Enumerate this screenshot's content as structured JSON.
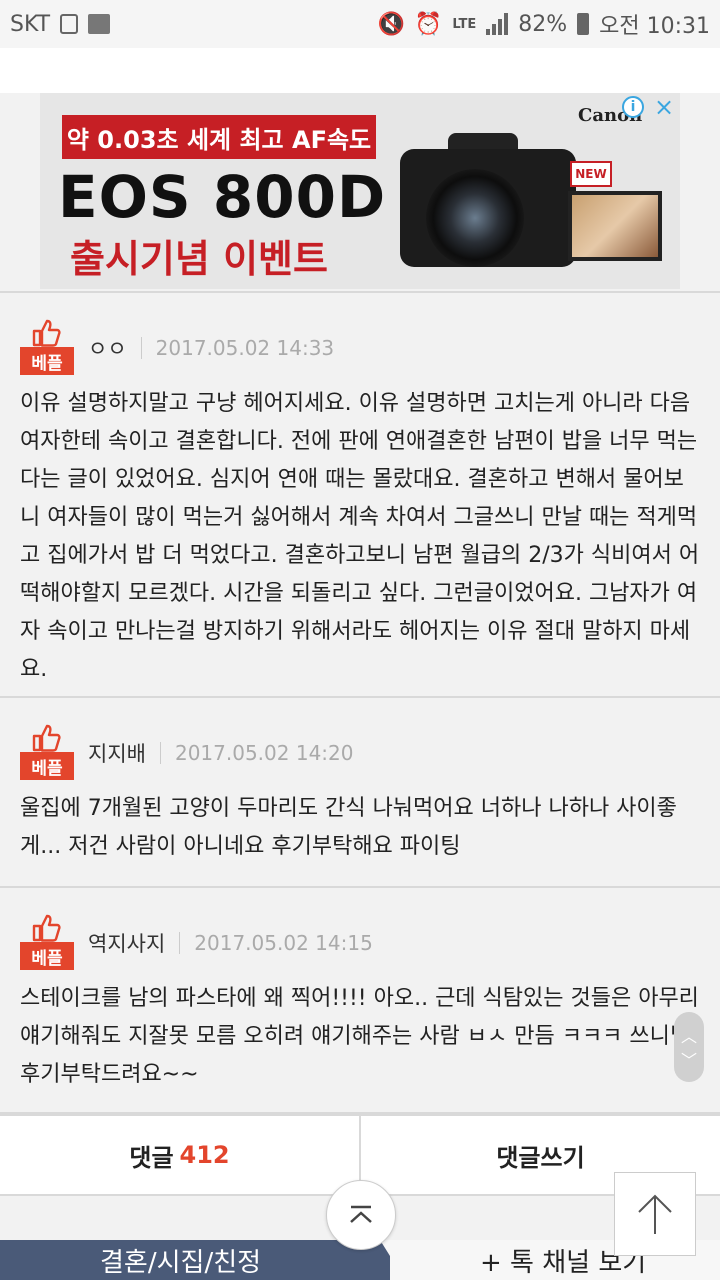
{
  "status_bar": {
    "carrier": "SKT",
    "network": "LTE",
    "battery": "82%",
    "time": "오전 10:31"
  },
  "ad": {
    "headline": "약 0.03초 세계 최고 AF속도",
    "model": "EOS 800D",
    "event": "출시기념 이벤트",
    "brand": "Canon",
    "new_badge": "NEW",
    "info_icon": "i",
    "close_icon": "×"
  },
  "best_label": "베플",
  "comments": [
    {
      "author": "ㅇㅇ",
      "date": "2017.05.02 14:33",
      "body": "이유 설명하지말고 구냥 헤어지세요. 이유 설명하면 고치는게 아니라 다음 여자한테 속이고 결혼합니다. 전에 판에 연애결혼한 남편이 밥을 너무 먹는다는 글이 있었어요. 심지어 연애 때는 몰랐대요. 결혼하고 변해서 물어보니 여자들이 많이 먹는거 싫어해서 계속 차여서 그글쓰니 만날 때는 적게먹고 집에가서 밥 더 먹었다고. 결혼하고보니 남편 월급의 2/3가 식비여서 어떡해야할지 모르겠다. 시간을 되돌리고 싶다. 그런글이었어요. 그남자가 여자 속이고 만나는걸 방지하기 위해서라도 헤어지는 이유 절대 말하지 마세요."
    },
    {
      "author": "지지배",
      "date": "2017.05.02 14:20",
      "body": "울집에 7개월된 고양이 두마리도 간식 나눠먹어요 너하나 나하나 사이좋게... 저건 사람이 아니네요 후기부탁해요 파이팅"
    },
    {
      "author": "역지사지",
      "date": "2017.05.02 14:15",
      "body": "스테이크를 남의 파스타에 왜 찍어!!!! 아오.. 근데 식탐있는 것들은 아무리 얘기해줘도 지잘못 모름 오히려 얘기해주는 사람 ㅂㅅ 만듬 ㅋㅋㅋ 쓰니님 후기부탁드려요~~"
    }
  ],
  "bottom_bar": {
    "comments_label": "댓글",
    "comments_count": "412",
    "write_label": "댓글쓰기"
  },
  "channel": {
    "current": "결혼/시집/친정",
    "more": "+ 톡 채널 보기"
  },
  "icons": [
    "thumbs-up-icon",
    "scroll-up-icon",
    "collapse-icon",
    "sd-card-icon",
    "image-icon",
    "mute-icon",
    "alarm-icon",
    "signal-icon",
    "battery-icon"
  ]
}
